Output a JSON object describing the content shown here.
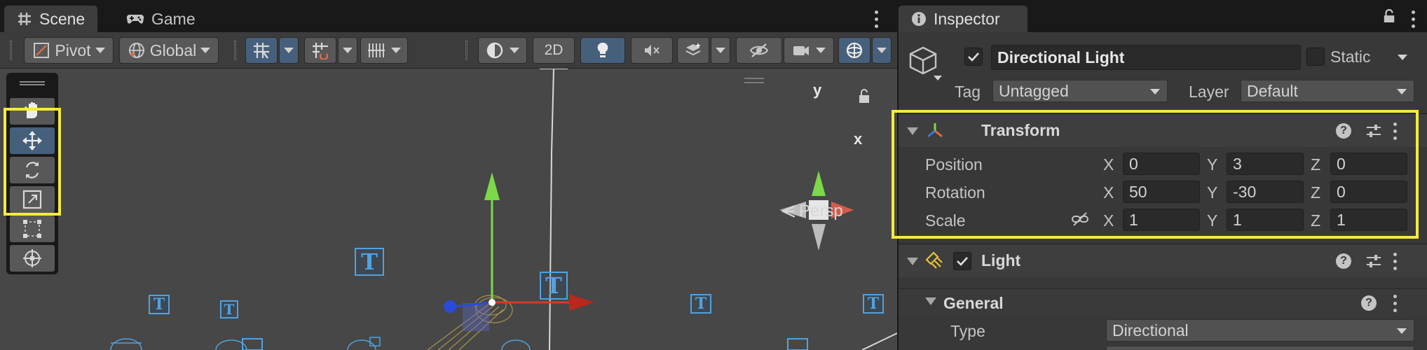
{
  "scene_window": {
    "tabs": [
      {
        "label": "Scene",
        "icon": "grid-icon"
      },
      {
        "label": "Game",
        "icon": "gamepad-icon"
      }
    ],
    "toolbar": {
      "pivot_label": "Pivot",
      "global_label": "Global",
      "mode_2d_label": "2D"
    },
    "tools": [
      "hand-tool",
      "move-tool",
      "rotate-tool",
      "scale-tool",
      "rect-tool",
      "transform-tool"
    ],
    "active_tool": "move-tool",
    "gizmo": {
      "y_label": "y",
      "x_label": "x",
      "projection_label": "Persp"
    },
    "highlight_color": "#f4ea3f"
  },
  "inspector": {
    "tab_label": "Inspector",
    "object": {
      "name": "Directional Light",
      "active": true,
      "static_label": "Static",
      "tag_label": "Tag",
      "tag_value": "Untagged",
      "layer_label": "Layer",
      "layer_value": "Default"
    },
    "transform": {
      "title": "Transform",
      "position": {
        "label": "Position",
        "x": "0",
        "y": "3",
        "z": "0"
      },
      "rotation": {
        "label": "Rotation",
        "x": "50",
        "y": "-30",
        "z": "0"
      },
      "scale": {
        "label": "Scale",
        "x": "1",
        "y": "1",
        "z": "1"
      },
      "axis_labels": {
        "x": "X",
        "y": "Y",
        "z": "Z"
      }
    },
    "light": {
      "title": "Light",
      "enabled": true,
      "general_label": "General",
      "type_label": "Type",
      "type_value": "Directional"
    }
  }
}
